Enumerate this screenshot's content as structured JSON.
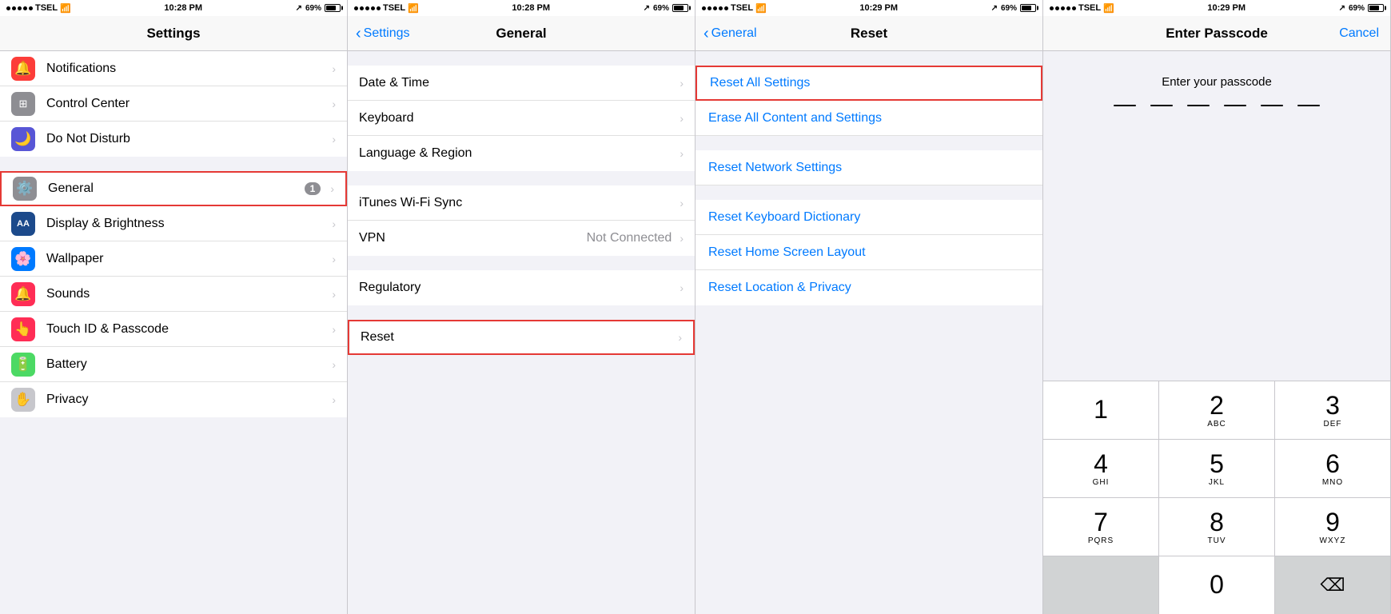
{
  "panels": [
    {
      "id": "settings",
      "statusBar": {
        "carrier": "TSEL",
        "wifi": true,
        "time": "10:28 PM",
        "location": true,
        "battery": "69%"
      },
      "navTitle": "Settings",
      "items": [
        {
          "id": "notifications",
          "label": "Notifications",
          "icon": "🔔",
          "iconBg": "icon-bg-red",
          "hasChevron": true,
          "badge": null,
          "value": null,
          "section": 0
        },
        {
          "id": "control-center",
          "label": "Control Center",
          "icon": "⊞",
          "iconBg": "icon-bg-gray",
          "hasChevron": true,
          "badge": null,
          "value": null,
          "section": 0
        },
        {
          "id": "do-not-disturb",
          "label": "Do Not Disturb",
          "icon": "🌙",
          "iconBg": "icon-bg-purple",
          "hasChevron": true,
          "badge": null,
          "value": null,
          "section": 0
        },
        {
          "id": "general",
          "label": "General",
          "icon": "⚙️",
          "iconBg": "icon-bg-gray",
          "hasChevron": true,
          "badge": "1",
          "value": null,
          "section": 1,
          "highlighted": true
        },
        {
          "id": "display-brightness",
          "label": "Display & Brightness",
          "icon": "AA",
          "iconBg": "icon-bg-blue-dark",
          "hasChevron": true,
          "badge": null,
          "value": null,
          "section": 1
        },
        {
          "id": "wallpaper",
          "label": "Wallpaper",
          "icon": "🌸",
          "iconBg": "icon-bg-blue",
          "hasChevron": true,
          "badge": null,
          "value": null,
          "section": 1
        },
        {
          "id": "sounds",
          "label": "Sounds",
          "icon": "🔔",
          "iconBg": "icon-bg-pink",
          "hasChevron": true,
          "badge": null,
          "value": null,
          "section": 1
        },
        {
          "id": "touch-id",
          "label": "Touch ID & Passcode",
          "icon": "👆",
          "iconBg": "icon-bg-pink",
          "hasChevron": true,
          "badge": null,
          "value": null,
          "section": 1
        },
        {
          "id": "battery",
          "label": "Battery",
          "icon": "🔋",
          "iconBg": "icon-bg-green",
          "hasChevron": true,
          "badge": null,
          "value": null,
          "section": 1
        },
        {
          "id": "privacy",
          "label": "Privacy",
          "icon": "✋",
          "iconBg": "icon-bg-silver",
          "hasChevron": true,
          "badge": null,
          "value": null,
          "section": 1
        }
      ]
    },
    {
      "id": "general",
      "statusBar": {
        "carrier": "TSEL",
        "wifi": true,
        "time": "10:28 PM",
        "location": true,
        "battery": "69%"
      },
      "navTitle": "General",
      "navBack": "Settings",
      "items": [
        {
          "id": "date-time",
          "label": "Date & Time",
          "icon": null,
          "hasChevron": true,
          "value": null,
          "section": 0
        },
        {
          "id": "keyboard",
          "label": "Keyboard",
          "icon": null,
          "hasChevron": true,
          "value": null,
          "section": 0
        },
        {
          "id": "language-region",
          "label": "Language & Region",
          "icon": null,
          "hasChevron": true,
          "value": null,
          "section": 0
        },
        {
          "id": "itunes-wifi",
          "label": "iTunes Wi-Fi Sync",
          "icon": null,
          "hasChevron": true,
          "value": null,
          "section": 1
        },
        {
          "id": "vpn",
          "label": "VPN",
          "icon": null,
          "hasChevron": true,
          "value": "Not Connected",
          "section": 1
        },
        {
          "id": "regulatory",
          "label": "Regulatory",
          "icon": null,
          "hasChevron": true,
          "value": null,
          "section": 2
        },
        {
          "id": "reset",
          "label": "Reset",
          "icon": null,
          "hasChevron": true,
          "value": null,
          "section": 3,
          "highlighted": true
        }
      ]
    },
    {
      "id": "reset",
      "statusBar": {
        "carrier": "TSEL",
        "wifi": true,
        "time": "10:29 PM",
        "location": true,
        "battery": "69%"
      },
      "navTitle": "Reset",
      "navBack": "General",
      "items": [
        {
          "id": "reset-all-settings",
          "label": "Reset All Settings",
          "highlighted": true,
          "section": 0
        },
        {
          "id": "erase-all",
          "label": "Erase All Content and Settings",
          "section": 0
        },
        {
          "id": "reset-network",
          "label": "Reset Network Settings",
          "section": 1
        },
        {
          "id": "reset-keyboard",
          "label": "Reset Keyboard Dictionary",
          "section": 2
        },
        {
          "id": "reset-home-screen",
          "label": "Reset Home Screen Layout",
          "section": 2
        },
        {
          "id": "reset-location",
          "label": "Reset Location & Privacy",
          "section": 2
        }
      ]
    },
    {
      "id": "passcode",
      "statusBar": {
        "carrier": "TSEL",
        "wifi": true,
        "time": "10:29 PM",
        "location": true,
        "battery": "69%"
      },
      "navTitle": "Enter Passcode",
      "navCancel": "Cancel",
      "prompt": "Enter your passcode",
      "dots": [
        "—",
        "—",
        "—",
        "—",
        "—",
        "—"
      ],
      "keypad": [
        [
          {
            "num": "1",
            "letters": ""
          },
          {
            "num": "2",
            "letters": "ABC"
          },
          {
            "num": "3",
            "letters": "DEF"
          }
        ],
        [
          {
            "num": "4",
            "letters": "GHI"
          },
          {
            "num": "5",
            "letters": "JKL"
          },
          {
            "num": "6",
            "letters": "MNO"
          }
        ],
        [
          {
            "num": "7",
            "letters": "PQRS"
          },
          {
            "num": "8",
            "letters": "TUV"
          },
          {
            "num": "9",
            "letters": "WXYZ"
          }
        ],
        [
          {
            "num": "",
            "letters": "",
            "disabled": true
          },
          {
            "num": "0",
            "letters": ""
          },
          {
            "num": "⌫",
            "letters": "",
            "delete": true
          }
        ]
      ]
    }
  ]
}
